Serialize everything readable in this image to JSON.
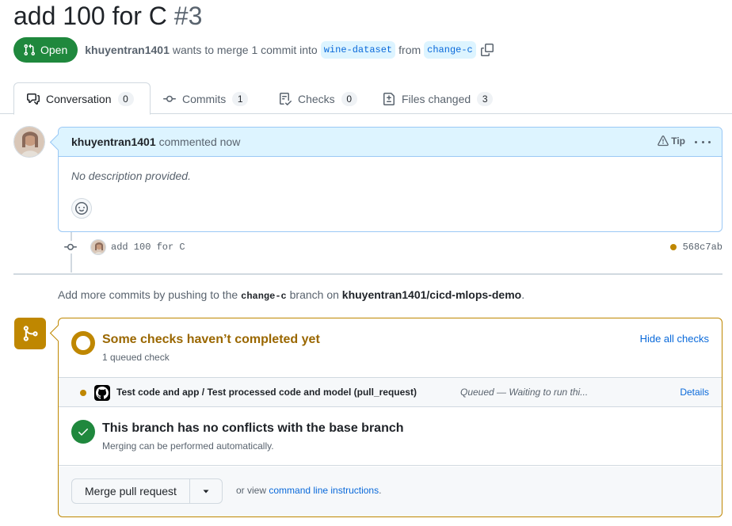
{
  "pr": {
    "title": "add 100 for C",
    "number": "#3",
    "state": "Open",
    "author": "khuyentran1401",
    "merge_text": "wants to merge 1 commit into",
    "base_branch": "wine-dataset",
    "from_text": "from",
    "head_branch": "change-c"
  },
  "tabs": [
    {
      "label": "Conversation",
      "count": "0",
      "icon": "comment-discussion-icon"
    },
    {
      "label": "Commits",
      "count": "1",
      "icon": "git-commit-icon"
    },
    {
      "label": "Checks",
      "count": "0",
      "icon": "checklist-icon"
    },
    {
      "label": "Files changed",
      "count": "3",
      "icon": "file-diff-icon"
    }
  ],
  "comment": {
    "author": "khuyentran1401",
    "when": "commented now",
    "tip": "Tip",
    "body": "No description provided."
  },
  "commit": {
    "message": "add 100 for C",
    "sha": "568c7ab"
  },
  "push_hint": {
    "prefix": "Add more commits by pushing to the",
    "branch": "change-c",
    "middle": "branch on",
    "repo": "khuyentran1401/cicd-mlops-demo",
    "suffix": "."
  },
  "checks": {
    "title": "Some checks haven’t completed yet",
    "subtitle": "1 queued check",
    "hide_label": "Hide all checks",
    "items": [
      {
        "name": "Test code and app / Test processed code and model (pull_request)",
        "status": "Queued — Waiting to run thi...",
        "details_label": "Details"
      }
    ]
  },
  "conflicts": {
    "title": "This branch has no conflicts with the base branch",
    "subtitle": "Merging can be performed automatically."
  },
  "merge": {
    "button_label": "Merge pull request",
    "or_view": "or view",
    "cli_link": "command line instructions",
    "cli_suffix": "."
  },
  "colors": {
    "open_green": "#1f883d",
    "pending_yellow": "#bf8700",
    "link_blue": "#0969da",
    "comment_header_bg": "#ddf4ff"
  }
}
